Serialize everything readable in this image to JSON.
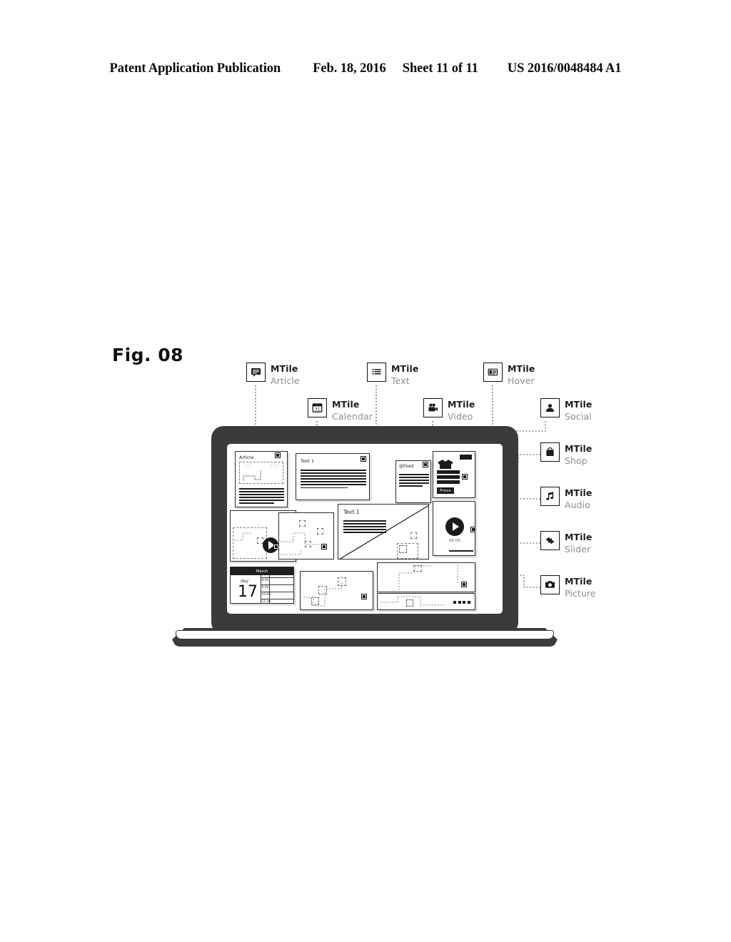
{
  "header": {
    "publication": "Patent Application Publication",
    "date": "Feb. 18, 2016",
    "sheet": "Sheet 11 of 11",
    "number": "US 2016/0048484 A1"
  },
  "figure": {
    "label": "Fig. 08"
  },
  "callouts": [
    {
      "id": "article",
      "title": "MTile",
      "subtitle": "Article",
      "icon": "article-icon"
    },
    {
      "id": "calendar",
      "title": "MTile",
      "subtitle": "Calendar",
      "icon": "calendar-icon"
    },
    {
      "id": "text",
      "title": "MTile",
      "subtitle": "Text",
      "icon": "text-list-icon"
    },
    {
      "id": "video",
      "title": "MTile",
      "subtitle": "Video",
      "icon": "video-camera-icon"
    },
    {
      "id": "hover",
      "title": "MTile",
      "subtitle": "Hover",
      "icon": "hover-card-icon"
    },
    {
      "id": "social",
      "title": "MTile",
      "subtitle": "Social",
      "icon": "person-icon"
    },
    {
      "id": "shop",
      "title": "MTile",
      "subtitle": "Shop",
      "icon": "shopping-bag-icon"
    },
    {
      "id": "audio",
      "title": "MTile",
      "subtitle": "Audio",
      "icon": "music-note-icon"
    },
    {
      "id": "slider",
      "title": "MTile",
      "subtitle": "Slider",
      "icon": "double-arrow-icon"
    },
    {
      "id": "picture",
      "title": "MTile",
      "subtitle": "Picture",
      "icon": "camera-icon"
    }
  ],
  "screen": {
    "tiles": {
      "article": {
        "label": "Article"
      },
      "text1": {
        "label": "Text 1"
      },
      "social": {
        "label": "@Feed"
      },
      "shop": {
        "button": "Press"
      },
      "text2": {
        "label": "Text 1"
      },
      "video": {
        "timecode": "00:00"
      },
      "calendar": {
        "header": "March",
        "day_label": "day",
        "day_number": "17",
        "slots": [
          "8:00",
          "9:00",
          "10:00",
          "11:00"
        ]
      }
    }
  },
  "colors": {
    "ink": "#1c1c1c",
    "device": "#3b3b3b",
    "muted_text": "#8e8e8e",
    "paper": "#ffffff"
  }
}
